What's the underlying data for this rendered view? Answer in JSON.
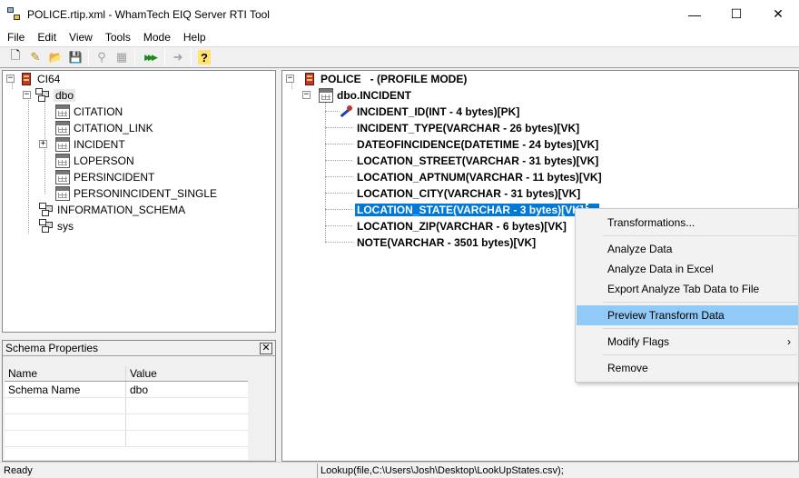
{
  "window": {
    "title": "POLICE.rtip.xml - WhamTech EIQ Server RTI Tool",
    "minimize": "—",
    "maximize": "☐",
    "close": "✕"
  },
  "menu": [
    "File",
    "Edit",
    "View",
    "Tools",
    "Mode",
    "Help"
  ],
  "toolbar": {
    "new": "🗋",
    "edit": "✎",
    "open": "📂",
    "save": "💾",
    "btn5": "⚲",
    "btn6": "▦",
    "run": "▶▶▶",
    "forward": "➜",
    "help": "?"
  },
  "left_tree": {
    "root": "CI64",
    "schema": "dbo",
    "tables": [
      "CITATION",
      "CITATION_LINK",
      "INCIDENT",
      "LOPERSON",
      "PERSINCIDENT",
      "PERSONINCIDENT_SINGLE"
    ],
    "other_schemas": [
      "INFORMATION_SCHEMA",
      "sys"
    ]
  },
  "schema_properties": {
    "title": "Schema Properties",
    "close": "✕",
    "col_name": "Name",
    "col_value": "Value",
    "rows": [
      {
        "name": "Schema Name",
        "value": "dbo"
      }
    ]
  },
  "right_tree": {
    "root": "POLICE   - (PROFILE MODE)",
    "table": "dbo.INCIDENT",
    "fields": [
      "INCIDENT_ID(INT - 4 bytes)[PK]",
      "INCIDENT_TYPE(VARCHAR - 26 bytes)[VK]",
      "DATEOFINCIDENCE(DATETIME - 24 bytes)[VK]",
      "LOCATION_STREET(VARCHAR - 31 bytes)[VK]",
      "LOCATION_APTNUM(VARCHAR - 11 bytes)[VK]",
      "LOCATION_CITY(VARCHAR - 31 bytes)[VK]",
      "LOCATION_STATE(VARCHAR - 3 bytes)[VK]",
      "LOCATION_ZIP(VARCHAR - 6 bytes)[VK]",
      "NOTE(VARCHAR - 3501 bytes)[VK]"
    ],
    "selected_index": 6
  },
  "context_menu": {
    "items": [
      "Transformations...",
      "Analyze Data",
      "Analyze Data in Excel",
      "Export Analyze Tab Data to File",
      "Preview Transform Data",
      "Modify Flags",
      "Remove"
    ],
    "highlighted": "Preview Transform Data",
    "submenu_arrow": "›"
  },
  "status": {
    "left": "Ready",
    "right": "Lookup(file,C:\\Users\\Josh\\Desktop\\LookUpStates.csv);"
  },
  "colors": {
    "selection": "#0078d7",
    "menu_highlight": "#91c9f7"
  }
}
